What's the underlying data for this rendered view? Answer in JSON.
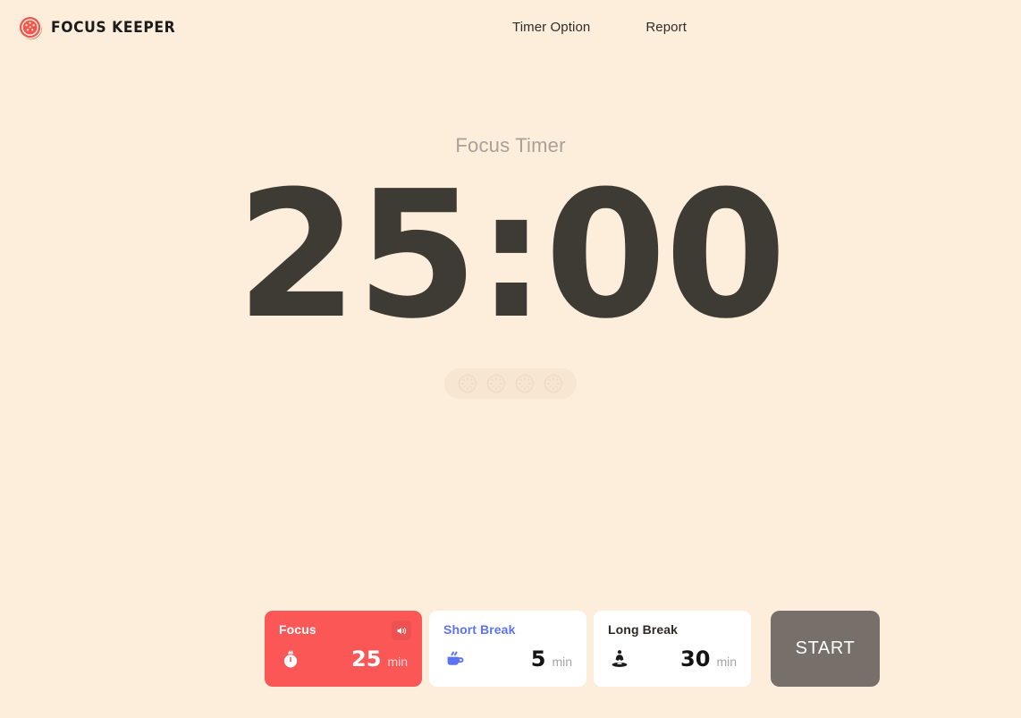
{
  "theme": {
    "background": "#FDEEDC",
    "accent_red": "#FC5757",
    "digits_color": "#3E3A34",
    "start_button": "#77706A",
    "short_break_color": "#5C72F5",
    "session_pill": "#F7E6D2"
  },
  "header": {
    "brand_name": "FOCUS KEEPER",
    "brand_icon": "tomato-logo-icon",
    "nav": [
      {
        "label": "Timer Option",
        "name": "nav-timer-option"
      },
      {
        "label": "Report",
        "name": "nav-report"
      }
    ]
  },
  "timer": {
    "title": "Focus Timer",
    "display": "25:00",
    "minutes": "25",
    "seconds": "00",
    "separator": ":",
    "session_indicators": {
      "count": 4,
      "completed": 0,
      "icon": "tomato-outline-icon"
    }
  },
  "controls": {
    "modes": [
      {
        "name": "focus",
        "label": "Focus",
        "value": "25",
        "unit": "min",
        "icon": "tomato-icon",
        "active": true,
        "sound_icon": "speaker-icon"
      },
      {
        "name": "short-break",
        "label": "Short Break",
        "value": "5",
        "unit": "min",
        "icon": "coffee-cup-icon",
        "active": false
      },
      {
        "name": "long-break",
        "label": "Long Break",
        "value": "30",
        "unit": "min",
        "icon": "meditation-icon",
        "active": false
      }
    ],
    "start_label": "START"
  }
}
